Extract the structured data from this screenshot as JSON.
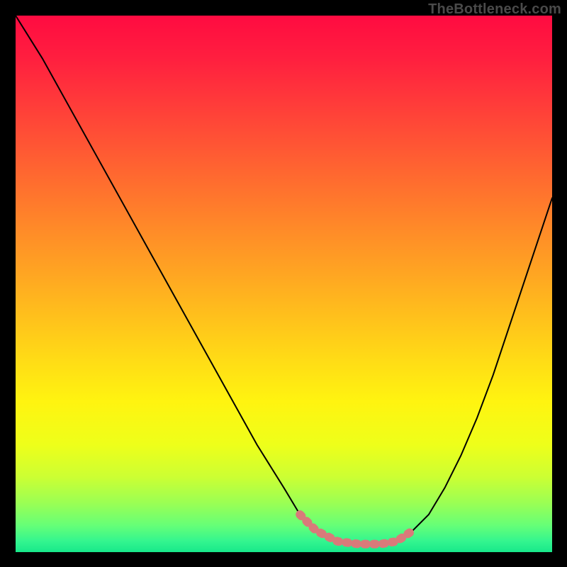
{
  "watermark": "TheBottleneck.com",
  "chart_data": {
    "type": "line",
    "title": "",
    "xlabel": "",
    "ylabel": "",
    "xlim": [
      0,
      100
    ],
    "ylim": [
      0,
      100
    ],
    "curve": {
      "x": [
        0,
        5,
        10,
        15,
        20,
        25,
        30,
        35,
        40,
        45,
        50,
        53,
        56,
        60,
        64,
        68,
        71,
        74,
        77,
        80,
        83,
        86,
        89,
        92,
        95,
        98,
        100
      ],
      "y": [
        100,
        92,
        83,
        74,
        65,
        56,
        47,
        38,
        29,
        20,
        12,
        7,
        4,
        2,
        1.5,
        1.5,
        2,
        4,
        7,
        12,
        18,
        25,
        33,
        42,
        51,
        60,
        66
      ]
    },
    "sweet_spot_marker": {
      "x": [
        53,
        56,
        60,
        64,
        68,
        71,
        74
      ],
      "y": [
        7,
        4,
        2,
        1.5,
        1.5,
        2,
        4
      ],
      "color": "#d97a7a",
      "width": 12
    },
    "gradient_stops": [
      {
        "offset": 0.0,
        "color": "#ff0b41"
      },
      {
        "offset": 0.08,
        "color": "#ff1f3f"
      },
      {
        "offset": 0.16,
        "color": "#ff3a3a"
      },
      {
        "offset": 0.24,
        "color": "#ff5534"
      },
      {
        "offset": 0.32,
        "color": "#ff702e"
      },
      {
        "offset": 0.4,
        "color": "#ff8b28"
      },
      {
        "offset": 0.48,
        "color": "#ffa522"
      },
      {
        "offset": 0.56,
        "color": "#ffc01c"
      },
      {
        "offset": 0.64,
        "color": "#ffdb16"
      },
      {
        "offset": 0.72,
        "color": "#fff410"
      },
      {
        "offset": 0.8,
        "color": "#eeff1a"
      },
      {
        "offset": 0.86,
        "color": "#ccff33"
      },
      {
        "offset": 0.91,
        "color": "#99ff55"
      },
      {
        "offset": 0.95,
        "color": "#66ff77"
      },
      {
        "offset": 0.98,
        "color": "#33f58f"
      },
      {
        "offset": 1.0,
        "color": "#18e88a"
      }
    ]
  }
}
